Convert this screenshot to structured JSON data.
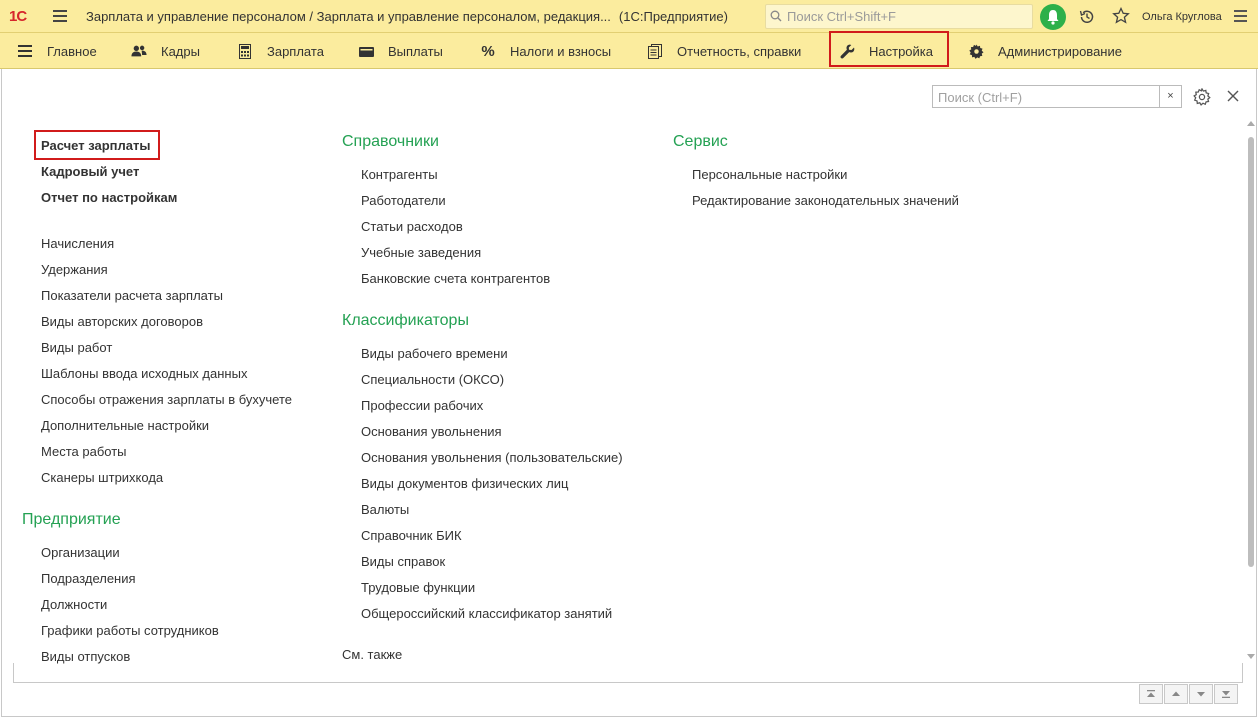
{
  "titlebar": {
    "logo": "1С",
    "title": "Зарплата и управление персоналом / Зарплата и управление персоналом, редакция...",
    "platform": "(1С:Предприятие)",
    "search_placeholder": "Поиск Ctrl+Shift+F",
    "user": "Ольга Круглова"
  },
  "sections": [
    {
      "label": "Главное",
      "icon": "hamburger-icon"
    },
    {
      "label": "Кадры",
      "icon": "people-icon"
    },
    {
      "label": "Зарплата",
      "icon": "calculator-icon"
    },
    {
      "label": "Выплаты",
      "icon": "wallet-icon"
    },
    {
      "label": "Налоги и взносы",
      "icon": "percent-icon"
    },
    {
      "label": "Отчетность, справки",
      "icon": "documents-icon"
    },
    {
      "label": "Настройка",
      "icon": "wrench-icon",
      "active": true
    },
    {
      "label": "Администрирование",
      "icon": "gear-icon"
    }
  ],
  "find": {
    "placeholder": "Поиск (Ctrl+F)",
    "clear": "×"
  },
  "col1": {
    "top": [
      "Расчет зарплаты",
      "Кадровый учет",
      "Отчет по настройкам"
    ],
    "links": [
      "Начисления",
      "Удержания",
      "Показатели расчета зарплаты",
      "Виды авторских договоров",
      "Виды работ",
      "Шаблоны ввода исходных данных",
      "Способы отражения зарплаты в бухучете",
      "Дополнительные настройки",
      "Места работы",
      "Сканеры штрихкода"
    ],
    "group": "Предприятие",
    "group_links": [
      "Организации",
      "Подразделения",
      "Должности",
      "Графики работы сотрудников",
      "Виды отпусков"
    ]
  },
  "col2": {
    "group1": "Справочники",
    "group1_links": [
      "Контрагенты",
      "Работодатели",
      "Статьи расходов",
      "Учебные заведения",
      "Банковские счета контрагентов"
    ],
    "group2": "Классификаторы",
    "group2_links": [
      "Виды рабочего времени",
      "Специальности (ОКСО)",
      "Профессии рабочих",
      "Основания увольнения",
      "Основания увольнения (пользовательские)",
      "Виды документов физических лиц",
      "Валюты",
      "Справочник БИК",
      "Виды справок",
      "Трудовые функции",
      "Общероссийский классификатор занятий"
    ],
    "see_also": "См. также"
  },
  "col3": {
    "group": "Сервис",
    "links": [
      "Персональные настройки",
      "Редактирование законодательных значений"
    ]
  },
  "colors": {
    "accent": "#24a153",
    "panel": "#fbec9e",
    "highlight": "#d11b1b"
  }
}
